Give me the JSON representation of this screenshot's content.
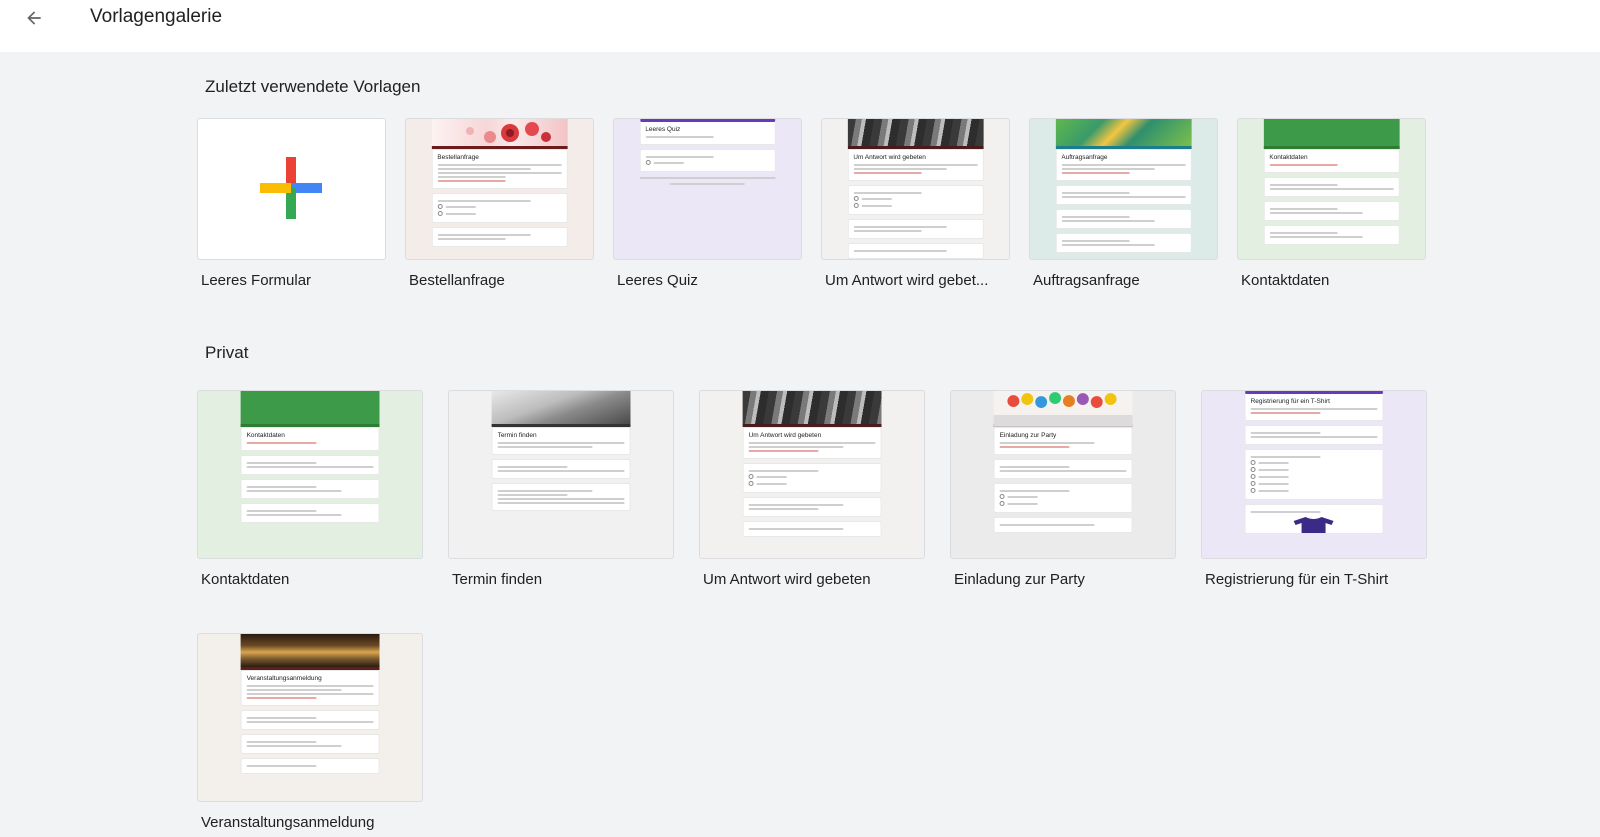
{
  "header": {
    "title": "Vorlagengalerie",
    "back_icon": "arrow-back-icon"
  },
  "sections": {
    "recent": {
      "title": "Zuletzt verwendete Vorlagen",
      "items": [
        {
          "label": "Leeres Formular"
        },
        {
          "label": "Bestellanfrage"
        },
        {
          "label": "Leeres Quiz"
        },
        {
          "label": "Um Antwort wird gebet..."
        },
        {
          "label": "Auftragsanfrage"
        },
        {
          "label": "Kontaktdaten"
        }
      ]
    },
    "private": {
      "title": "Privat",
      "items": [
        {
          "label": "Kontaktdaten"
        },
        {
          "label": "Termin finden"
        },
        {
          "label": "Um Antwort wird gebeten"
        },
        {
          "label": "Einladung zur Party"
        },
        {
          "label": "Registrierung für ein T-Shirt"
        },
        {
          "label": "Veranstaltungsanmeldung"
        }
      ]
    }
  },
  "previews": {
    "bestellanfrage": "Bestellanfrage",
    "leeres_quiz": "Leeres Quiz",
    "um_antwort": "Um Antwort wird gebeten",
    "auftragsanfrage": "Auftragsanfrage",
    "kontaktdaten": "Kontaktdaten",
    "termin_finden": "Termin finden",
    "einladung": "Einladung zur Party",
    "registrierung": "Registrierung für ein T-Shirt",
    "veranstaltung": "Veranstaltungsanmeldung"
  },
  "colors": {
    "background": "#f1f3f4",
    "plus_blue": "#4285f4",
    "plus_red": "#ea4335",
    "plus_yellow": "#fbbc04",
    "plus_green": "#34a853"
  }
}
